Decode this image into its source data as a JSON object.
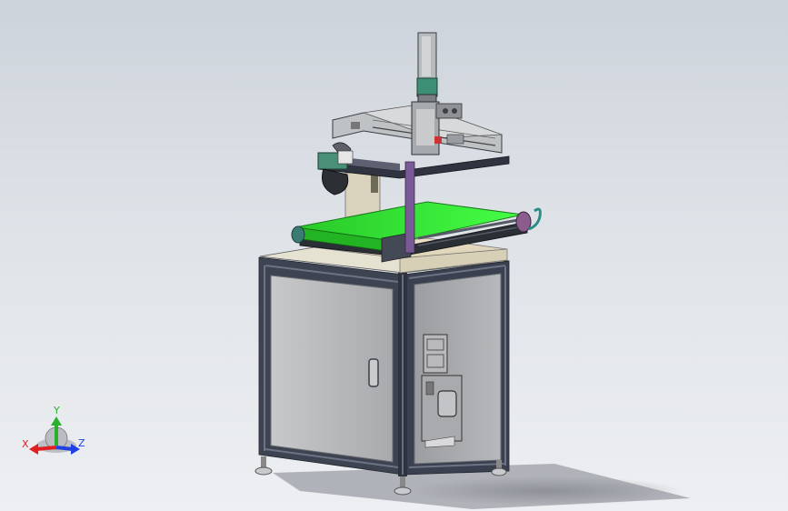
{
  "viewport": {
    "background_top": "#cdd3db",
    "background_bottom": "#edeff2",
    "scene": "cad-3d-model"
  },
  "model": {
    "belt_color": "#2fe02f",
    "frame_color": "#3d4350",
    "panel_color": "#b8b9bb",
    "accent_purple": "#7a5a96",
    "accent_teal": "#2e8a80"
  },
  "triad": {
    "x_label": "X",
    "y_label": "Y",
    "z_label": "Z",
    "x_color": "#e02020",
    "y_color": "#2ab02a",
    "z_color": "#2040e0"
  }
}
